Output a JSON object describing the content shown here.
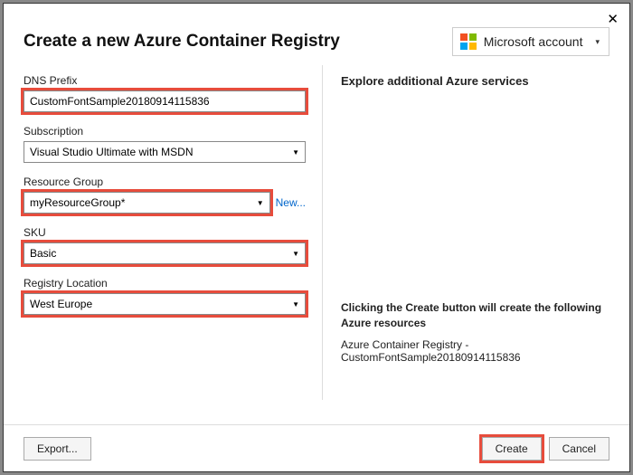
{
  "header": {
    "title": "Create a new Azure Container Registry",
    "account_label": "Microsoft account"
  },
  "fields": {
    "dns": {
      "label": "DNS Prefix",
      "value": "CustomFontSample20180914115836"
    },
    "subscription": {
      "label": "Subscription",
      "value": "Visual Studio Ultimate with MSDN"
    },
    "rg": {
      "label": "Resource Group",
      "value": "myResourceGroup*",
      "new_link": "New..."
    },
    "sku": {
      "label": "SKU",
      "value": "Basic"
    },
    "location": {
      "label": "Registry Location",
      "value": "West Europe"
    }
  },
  "right": {
    "explore": "Explore additional Azure services",
    "note": "Clicking the Create button will create the following Azure resources",
    "resource": "Azure Container Registry - CustomFontSample20180914115836"
  },
  "footer": {
    "export": "Export...",
    "create": "Create",
    "cancel": "Cancel"
  }
}
